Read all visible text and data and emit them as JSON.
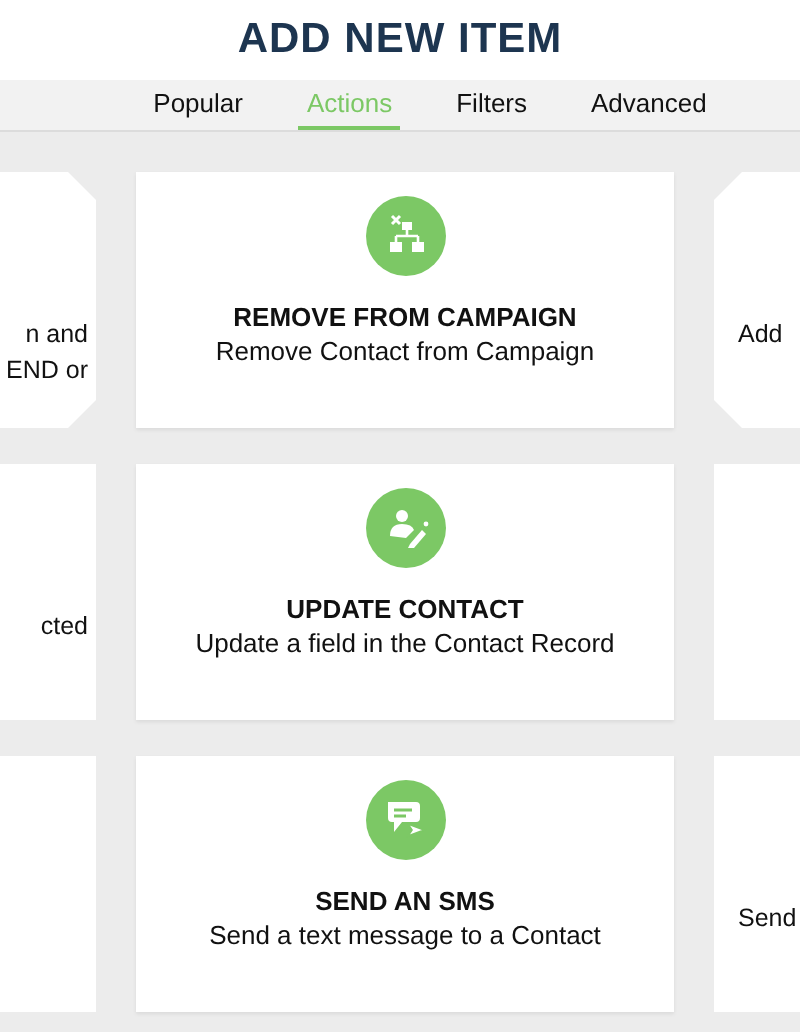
{
  "title": "ADD NEW ITEM",
  "tabs": [
    {
      "label": "Popular",
      "selected": false
    },
    {
      "label": "Actions",
      "selected": true
    },
    {
      "label": "Filters",
      "selected": false
    },
    {
      "label": "Advanced",
      "selected": false
    }
  ],
  "rows": [
    {
      "cards": [
        {
          "kind": "partial",
          "chamfered": true,
          "lines": [
            "n and",
            "END or"
          ]
        },
        {
          "kind": "full",
          "title": "REMOVE FROM CAMPAIGN",
          "description": "Remove Contact from Campaign"
        },
        {
          "kind": "partial",
          "chamfered": true,
          "lines": [
            "Add"
          ]
        }
      ]
    },
    {
      "cards": [
        {
          "kind": "partial",
          "chamfered": false,
          "lines": [
            "cted"
          ]
        },
        {
          "kind": "full",
          "title": "UPDATE CONTACT",
          "description": "Update a field in the Contact Record"
        },
        {
          "kind": "partial",
          "chamfered": false
        }
      ]
    },
    {
      "cards": [
        {
          "kind": "partial",
          "chamfered": false
        },
        {
          "kind": "full",
          "title": "SEND AN SMS",
          "description": "Send a text message to a Contact"
        },
        {
          "kind": "partial",
          "chamfered": false,
          "lines": [
            "Send"
          ]
        }
      ]
    }
  ]
}
